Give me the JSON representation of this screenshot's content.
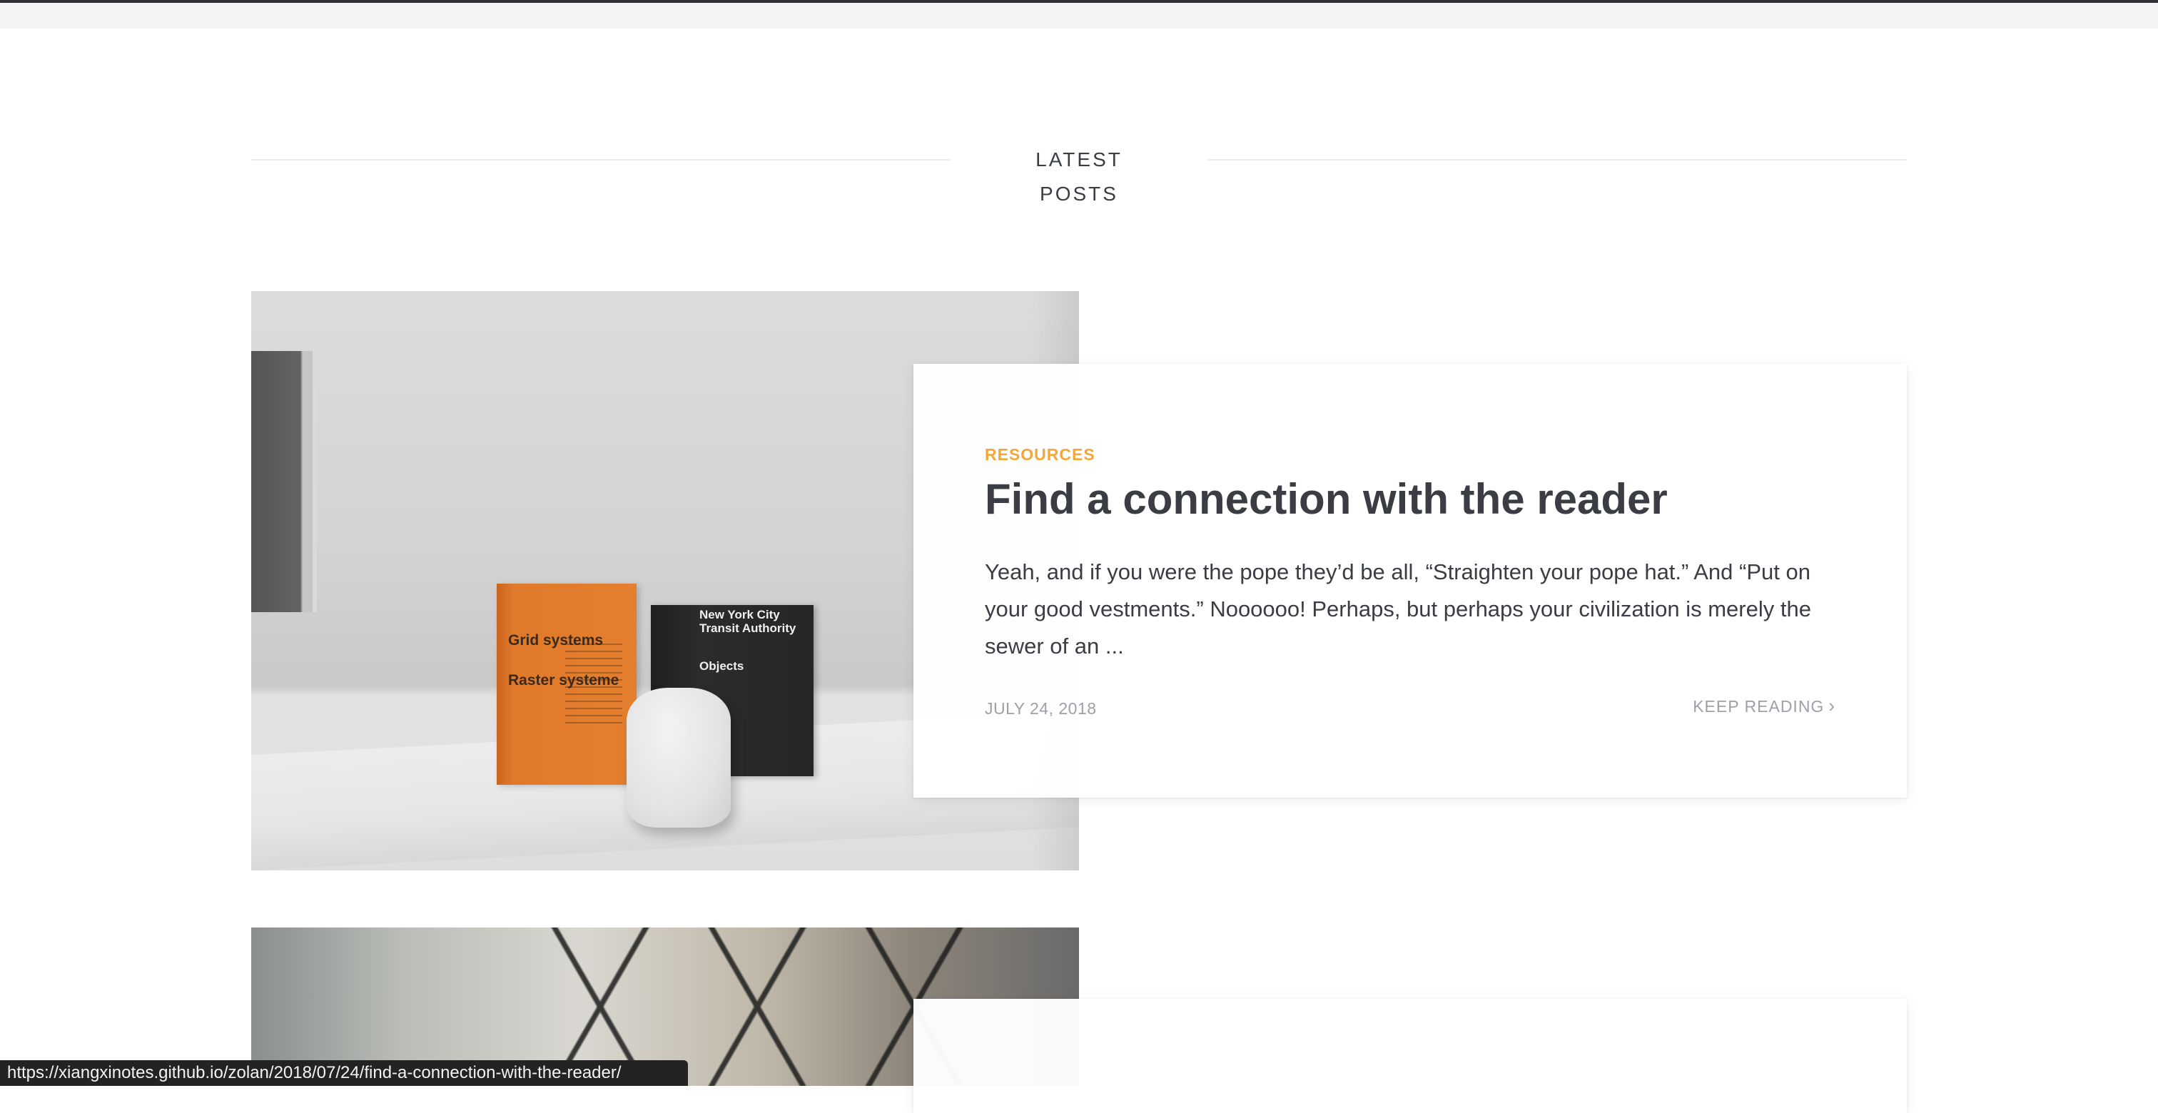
{
  "section": {
    "title": "LATEST POSTS"
  },
  "posts": [
    {
      "category": "RESOURCES",
      "title": "Find a connection with the reader",
      "excerpt": "Yeah, and if you were the pope they’d be all, “Straighten your pope hat.” And “Put on your good vestments.” Noooooo! Perhaps, but perhaps your civilization is merely the sewer of an ...",
      "date": "JULY 24, 2018",
      "keep_reading": "KEEP READING",
      "image": {
        "book_orange_title_1": "Grid systems",
        "book_orange_title_2": "Raster systeme",
        "book_black_title": "New York City Transit Authority",
        "book_black_subtitle": "Objects"
      }
    }
  ],
  "status_bar": {
    "url": "https://xiangxinotes.github.io/zolan/2018/07/24/find-a-connection-with-the-reader/"
  },
  "icons": {
    "keep_reading_chevron": "chevron-right-icon"
  },
  "colors": {
    "category": "#f2a73b",
    "text": "#3a3e44",
    "muted": "#9da1a6"
  }
}
